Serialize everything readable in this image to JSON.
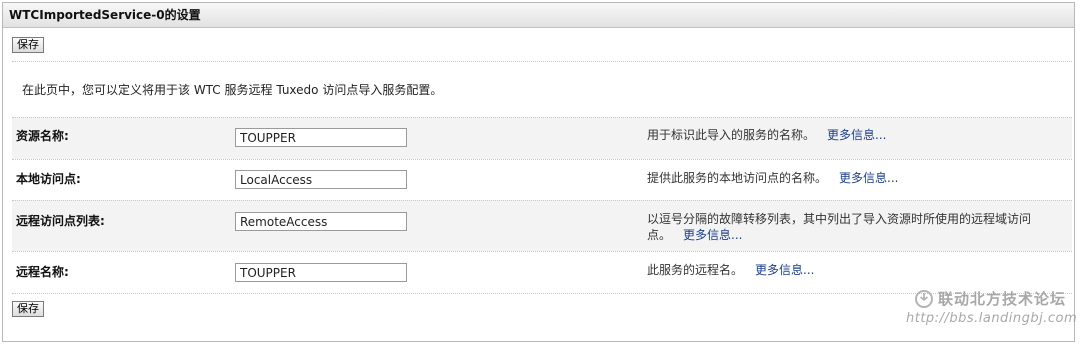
{
  "panel": {
    "title": "WTCImportedService-0的设置"
  },
  "buttons": {
    "save_label": "保存"
  },
  "intro": "在此页中，您可以定义将用于该 WTC 服务远程 Tuxedo 访问点导入服务配置。",
  "more_info_label": "更多信息...",
  "rows": [
    {
      "label": "资源名称:",
      "value": "TOUPPER",
      "help": "用于标识此导入的服务的名称。"
    },
    {
      "label": "本地访问点:",
      "value": "LocalAccess",
      "help": "提供此服务的本地访问点的名称。"
    },
    {
      "label": "远程访问点列表:",
      "value": "RemoteAccess",
      "help": "以逗号分隔的故障转移列表，其中列出了导入资源时所使用的远程域访问点。"
    },
    {
      "label": "远程名称:",
      "value": "TOUPPER",
      "help": "此服务的远程名。"
    }
  ],
  "watermark": {
    "title": "联动北方技术论坛",
    "url": "http://bbs.landingbj.com"
  }
}
